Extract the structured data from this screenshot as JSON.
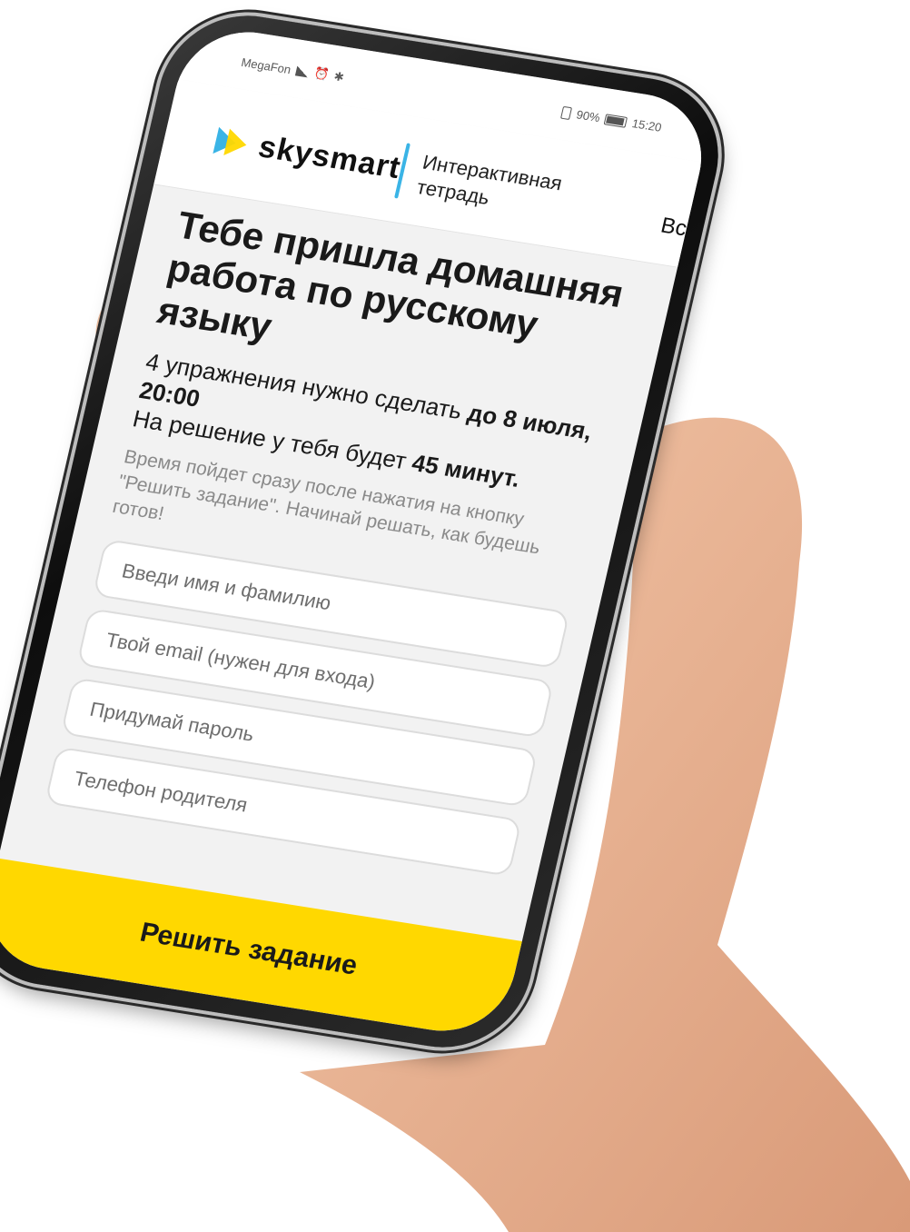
{
  "status_bar": {
    "carrier": "MegaFon",
    "battery": "90%",
    "time": "15:20"
  },
  "header": {
    "brand": "skysmart",
    "subtitle": "Интерактивная тетрадь",
    "more": "Вс"
  },
  "main": {
    "title": "Тебе пришла домашняя работа по русскому языку",
    "exercises_text": "4 упражнения нужно сделать ",
    "deadline_prefix": "до",
    "deadline": "8 июля, 20:00",
    "time_text": "На решение у тебя будет ",
    "time_value": "45 минут.",
    "hint": "Время пойдет сразу после нажатия на кнопку \"Решить задание\". Начинай решать, как будешь готов!"
  },
  "form": {
    "name_placeholder": "Введи имя и фамилию",
    "email_placeholder": "Твой email (нужен для входа)",
    "password_placeholder": "Придумай пароль",
    "phone_placeholder": "Телефон родителя",
    "submit_label": "Решить задание"
  },
  "colors": {
    "accent": "#ffd800",
    "brand_blue": "#3ab4e6",
    "background": "#f2f2f2"
  }
}
